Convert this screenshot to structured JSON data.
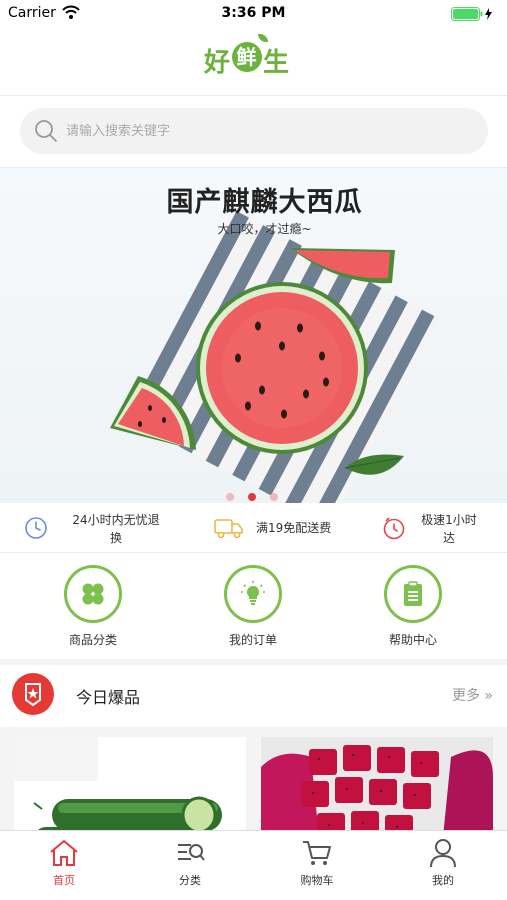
{
  "status_bar": {
    "carrier": "Carrier",
    "time": "3:36 PM"
  },
  "header": {
    "logo_text": [
      "好",
      "鲜",
      "生"
    ]
  },
  "search": {
    "placeholder": "请输入搜索关键字"
  },
  "banner": {
    "title": "国产麒麟大西瓜",
    "subtitle": "大口咬，才过瘾~",
    "page_count": 3,
    "active_page": 2
  },
  "services": [
    {
      "icon": "clock-icon",
      "line1": "24小时内无忧退",
      "line2": "换"
    },
    {
      "icon": "delivery-truck-icon",
      "line1": "满19免配送费",
      "line2": ""
    },
    {
      "icon": "timer-icon",
      "line1": "极速1小时",
      "line2": "达"
    }
  ],
  "entries": [
    {
      "icon": "category-icon",
      "label": "商品分类"
    },
    {
      "icon": "lightbulb-icon",
      "label": "我的订单"
    },
    {
      "icon": "clipboard-icon",
      "label": "帮助中心"
    }
  ],
  "section": {
    "title": "今日爆品",
    "more": "更多 »"
  },
  "tabbar": [
    {
      "icon": "home-icon",
      "label": "首页",
      "active": true
    },
    {
      "icon": "category-search-icon",
      "label": "分类",
      "active": false
    },
    {
      "icon": "shopping-cart-icon",
      "label": "购物车",
      "active": false
    },
    {
      "icon": "user-icon",
      "label": "我的",
      "active": false
    }
  ],
  "colors": {
    "accent_red": "#e23a3a",
    "brand_green": "#6cb33e",
    "entry_green": "#7cc04e"
  }
}
